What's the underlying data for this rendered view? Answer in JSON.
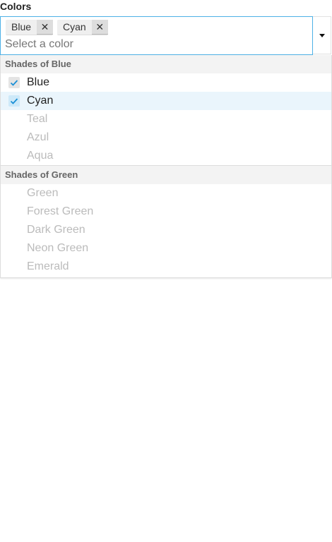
{
  "label": "Colors",
  "selected": [
    {
      "label": "Blue",
      "remove": "✕"
    },
    {
      "label": "Cyan",
      "remove": "✕"
    }
  ],
  "placeholder": "Select a color",
  "groups": [
    {
      "title": "Shades of Blue",
      "options": [
        "Blue",
        "Cyan",
        "Teal",
        "Azul",
        "Aqua"
      ]
    },
    {
      "title": "Shades of Green",
      "options": [
        "Green",
        "Forest Green",
        "Dark Green",
        "Neon Green",
        "Emerald"
      ]
    }
  ],
  "accent": "#4db1e6"
}
